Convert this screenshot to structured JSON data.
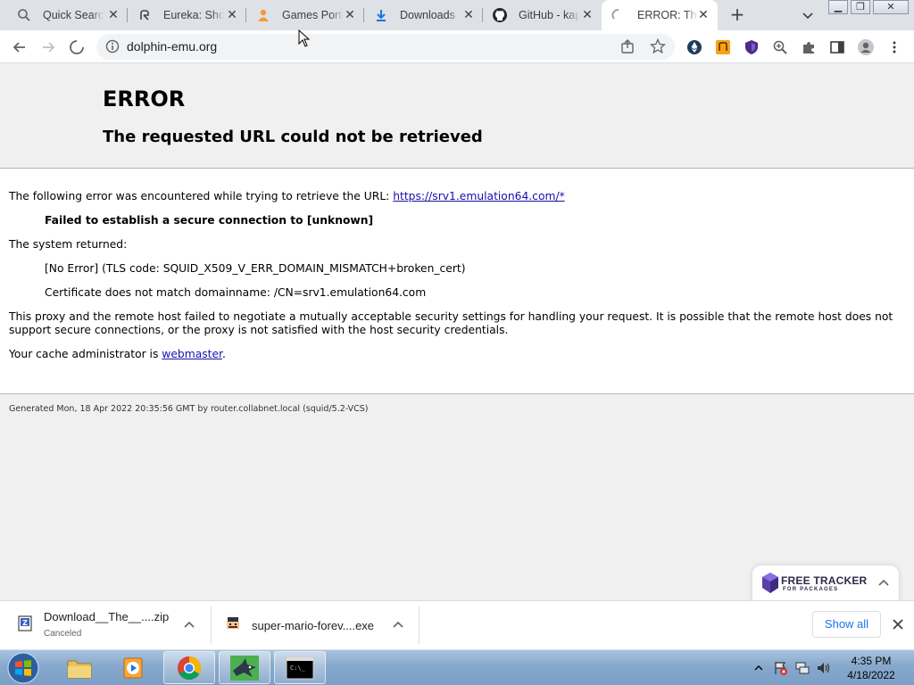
{
  "browser": {
    "tabs": [
      {
        "title": "Quick Search",
        "icon": "magnifier-icon"
      },
      {
        "title": "Eureka: Shop",
        "icon": "eureka-icon"
      },
      {
        "title": "Games Portal",
        "icon": "games-icon"
      },
      {
        "title": "Downloads",
        "icon": "download-icon"
      },
      {
        "title": "GitHub - kap",
        "icon": "github-icon"
      },
      {
        "title": "ERROR: The",
        "icon": "loading-spinner-icon"
      }
    ],
    "url": "dolphin-emu.org"
  },
  "error_page": {
    "heading": "ERROR",
    "subheading": "The requested URL could not be retrieved",
    "intro": "The following error was encountered while trying to retrieve the URL: ",
    "intro_link": "https://srv1.emulation64.com/*",
    "failure": "Failed to establish a secure connection to [unknown]",
    "system_returned": "The system returned:",
    "returned_detail": "[No Error] (TLS code: SQUID_X509_V_ERR_DOMAIN_MISMATCH+broken_cert)",
    "cert_detail": "Certificate does not match domainname: /CN=srv1.emulation64.com",
    "explanation_line1": "This proxy and the remote host failed to negotiate a mutually acceptable security settings for handling your request. It is possible that the remote host does not",
    "explanation_line2": "support secure connections, or the proxy is not satisfied with the host security credentials.",
    "admin_prefix": "Your cache administrator is ",
    "admin_link": "webmaster",
    "admin_suffix": ".",
    "generated": "Generated Mon, 18 Apr 2022 20:35:56 GMT by router.collabnet.local (squid/5.2-VCS)"
  },
  "tracker_widget": {
    "title": "FREE TRACKER",
    "subtitle": "FOR PACKAGES"
  },
  "downloads": {
    "items": [
      {
        "name": "Download__The__....zip",
        "status": "Canceled"
      },
      {
        "name": "super-mario-forev....exe",
        "status": ""
      }
    ],
    "show_all": "Show all"
  },
  "taskbar": {
    "time": "4:35 PM",
    "date": "4/18/2022"
  }
}
